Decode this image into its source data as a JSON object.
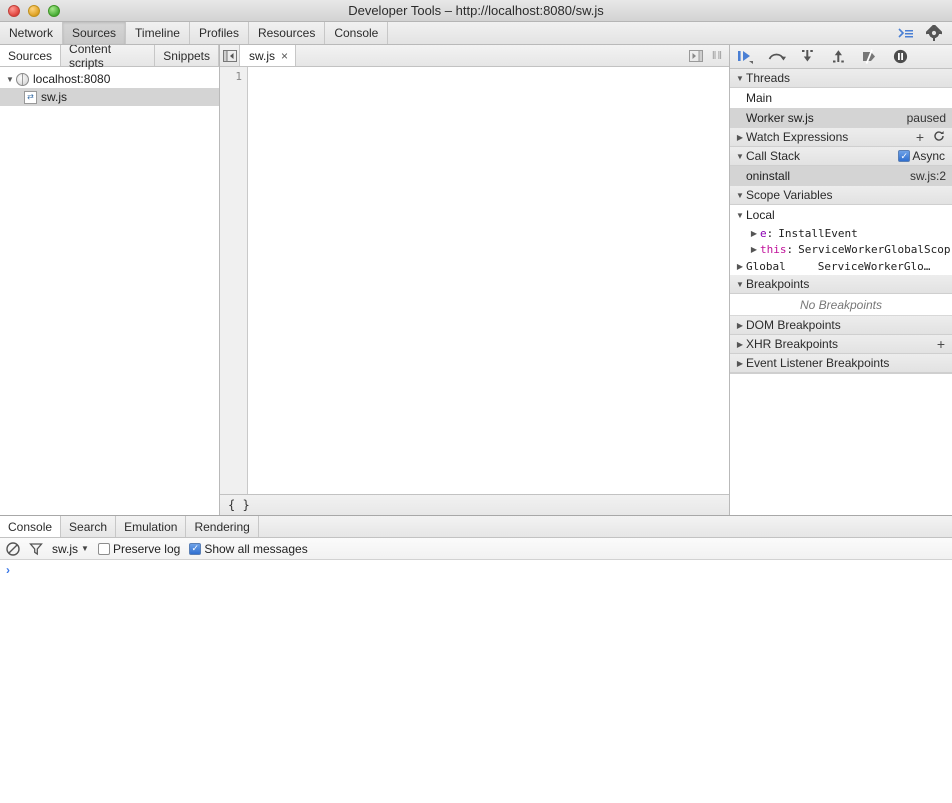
{
  "window": {
    "title": "Developer Tools – http://localhost:8080/sw.js",
    "controls": {
      "close": "close-button",
      "minimize": "minimize-button",
      "zoom": "zoom-button"
    }
  },
  "main_tabs": {
    "items": [
      {
        "label": "Network",
        "selected": false
      },
      {
        "label": "Sources",
        "selected": true
      },
      {
        "label": "Timeline",
        "selected": false
      },
      {
        "label": "Profiles",
        "selected": false
      },
      {
        "label": "Resources",
        "selected": false
      },
      {
        "label": "Console",
        "selected": false
      }
    ],
    "right_icons": [
      {
        "name": "console-drawer-toggle-icon",
        "glyph": "›≡"
      },
      {
        "name": "settings-gear-icon",
        "glyph": "⚙"
      }
    ]
  },
  "navigator": {
    "tabs": [
      {
        "label": "Sources",
        "selected": true
      },
      {
        "label": "Content scripts",
        "selected": false
      },
      {
        "label": "Snippets",
        "selected": false
      }
    ],
    "tree": [
      {
        "label": "localhost:8080",
        "type": "domain",
        "expanded": true,
        "selected": false,
        "indent": 0
      },
      {
        "label": "sw.js",
        "type": "script",
        "expanded": false,
        "selected": true,
        "indent": 1
      }
    ]
  },
  "editor": {
    "tabs": [
      {
        "label": "sw.js",
        "close": "×",
        "selected": true
      }
    ],
    "nav_back_icon": "navigator-toggle-icon",
    "nav_forward_icon": "sidebar-toggle-icon",
    "grip": "‖‖",
    "line_numbers": [
      "1"
    ],
    "content": "",
    "status_bar": {
      "pretty_print": "{ }"
    }
  },
  "debugger": {
    "toolbar": [
      {
        "name": "resume-script-execution-button",
        "title": "Resume"
      },
      {
        "name": "step-over-button",
        "title": "Step over"
      },
      {
        "name": "step-into-button",
        "title": "Step into"
      },
      {
        "name": "step-out-button",
        "title": "Step out"
      },
      {
        "name": "deactivate-breakpoints-button",
        "title": "Deactivate breakpoints"
      },
      {
        "name": "pause-on-exceptions-button",
        "title": "Pause on exceptions"
      }
    ],
    "sections": {
      "threads": {
        "title": "Threads",
        "expanded": true,
        "rows": [
          {
            "label": "Main",
            "status": "",
            "selected": false
          },
          {
            "label": "Worker sw.js",
            "status": "paused",
            "selected": true
          }
        ]
      },
      "watch_expressions": {
        "title": "Watch Expressions",
        "expanded": false,
        "add": "+",
        "refresh": "↻"
      },
      "call_stack": {
        "title": "Call Stack",
        "expanded": true,
        "async_label": "Async",
        "async_checked": true,
        "frames": [
          {
            "name": "oninstall",
            "location": "sw.js:2",
            "selected": true
          }
        ]
      },
      "scope_variables": {
        "title": "Scope Variables",
        "expanded": true,
        "scopes": [
          {
            "name": "Local",
            "expanded": true,
            "properties": [
              {
                "key": "e",
                "separator": ":",
                "value": "InstallEvent",
                "key_color": "#8b00b3"
              },
              {
                "key": "this",
                "separator": ":",
                "value": "ServiceWorkerGlobalScop",
                "key_color": "#c0119a"
              }
            ]
          },
          {
            "name": "Global",
            "expanded": false,
            "value": "ServiceWorkerGlo…",
            "properties": []
          }
        ]
      },
      "breakpoints": {
        "title": "Breakpoints",
        "expanded": true,
        "empty_text": "No Breakpoints"
      },
      "dom_breakpoints": {
        "title": "DOM Breakpoints",
        "expanded": false
      },
      "xhr_breakpoints": {
        "title": "XHR Breakpoints",
        "expanded": false,
        "add": "+"
      },
      "event_listener_breakpoints": {
        "title": "Event Listener Breakpoints",
        "expanded": false
      }
    }
  },
  "drawer": {
    "tabs": [
      {
        "label": "Console",
        "selected": true
      },
      {
        "label": "Search",
        "selected": false
      },
      {
        "label": "Emulation",
        "selected": false
      },
      {
        "label": "Rendering",
        "selected": false
      }
    ],
    "toolbar": {
      "clear_icon": "clear-console-icon",
      "filter_icon": "filter-icon",
      "context_selector": "sw.js",
      "preserve_log": {
        "label": "Preserve log",
        "checked": false
      },
      "show_all_messages": {
        "label": "Show all messages",
        "checked": true
      }
    },
    "prompt": "›",
    "messages": []
  },
  "colors": {
    "accent_blue": "#3b78e7",
    "selected_row": "#d4d4d4",
    "chrome_gray": "#e6e6e6",
    "border": "#b9b9b9"
  }
}
